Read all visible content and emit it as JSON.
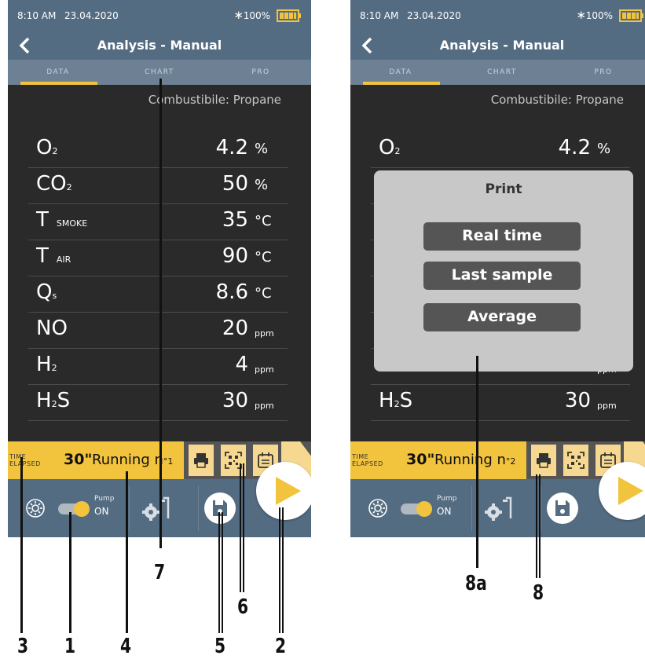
{
  "status": {
    "time": "8:10 AM",
    "date": "23.04.2020",
    "bluetooth": "bluetooth-icon",
    "battery": "100%"
  },
  "nav": {
    "title": "Analysis - Manual"
  },
  "tabs": [
    {
      "label": "DATA"
    },
    {
      "label": "CHART"
    },
    {
      "label": "PRO"
    }
  ],
  "fuel_left": "Combustibile: Propane",
  "fuel_right": "Combustibile: Propane",
  "rows": [
    {
      "main": "O",
      "sub": "2",
      "value": "4.2",
      "unit": "%"
    },
    {
      "main": "CO",
      "sub": "2",
      "value": "50",
      "unit": "%"
    },
    {
      "main": "T",
      "sub": "SMOKE",
      "value": "35",
      "unit": "°C"
    },
    {
      "main": "T",
      "sub": "AIR",
      "value": "90",
      "unit": "°C"
    },
    {
      "main": "Q",
      "sub": "s",
      "value": "8.6",
      "unit": "°C"
    },
    {
      "main": "NO",
      "sub": "",
      "value": "20",
      "unit": "ppm"
    },
    {
      "main": "H",
      "sub": "2",
      "value": "4",
      "unit": "ppm"
    },
    {
      "main": "H",
      "sub": "2",
      "tail": "S",
      "value": "30",
      "unit": "ppm"
    }
  ],
  "bar": {
    "time_label_1": "TIME",
    "time_label_2": "ELAPSED",
    "elapsed": "30\"",
    "running_left": "Running n",
    "running_left_num": "°1",
    "running_right": "Running n",
    "running_right_num": "°2"
  },
  "controls": {
    "pump_label": "Pump",
    "pump_state": "ON"
  },
  "dialog": {
    "title": "Print",
    "buttons": [
      {
        "label": "Real time"
      },
      {
        "label": "Last sample"
      },
      {
        "label": "Average"
      }
    ]
  },
  "callouts": {
    "c1": "1",
    "c2": "2",
    "c3": "3",
    "c4": "4",
    "c5": "5",
    "c6": "6",
    "c7": "7",
    "c8": "8",
    "c8a": "8a"
  },
  "colors": {
    "header": "#546c82",
    "accent": "#f2c33c",
    "screen": "#2a2a2a"
  }
}
